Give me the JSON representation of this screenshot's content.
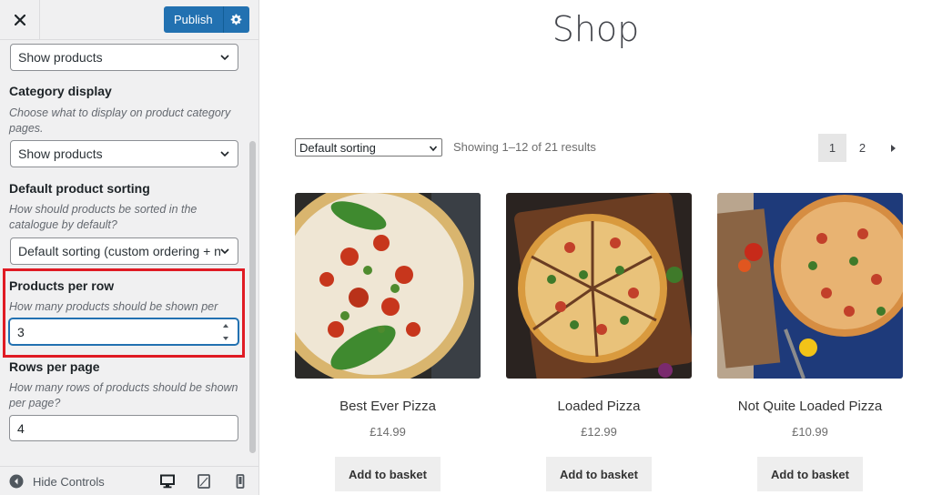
{
  "sidebar": {
    "close_label": "×",
    "publish_label": "Publish",
    "shop_page_display_value": "Show products",
    "category_display": {
      "label": "Category display",
      "description": "Choose what to display on product category pages.",
      "value": "Show products"
    },
    "default_sorting": {
      "label": "Default product sorting",
      "description": "How should products be sorted in the catalogue by default?",
      "value": "Default sorting (custom ordering + na"
    },
    "products_per_row": {
      "label": "Products per row",
      "description": "How many products should be shown per row?",
      "value": "3"
    },
    "rows_per_page": {
      "label": "Rows per page",
      "description": "How many rows of products should be shown per page?",
      "value": "4"
    },
    "footer": {
      "hide_controls_label": "Hide Controls"
    }
  },
  "preview": {
    "page_title": "Shop",
    "sorting_value": "Default sorting",
    "result_count": "Showing 1–12 of 21 results",
    "pagination": [
      "1",
      "2"
    ],
    "products": [
      {
        "name": "Best Ever Pizza",
        "price": "£14.99",
        "button": "Add to basket"
      },
      {
        "name": "Loaded Pizza",
        "price": "£12.99",
        "button": "Add to basket"
      },
      {
        "name": "Not Quite Loaded Pizza",
        "price": "£10.99",
        "button": "Add to basket"
      }
    ]
  },
  "colors": {
    "accent": "#2271b1",
    "highlight": "#e01b24",
    "sidebar_bg": "#f0f0f1"
  },
  "icons": [
    "close-icon",
    "gear-icon",
    "chevron-down-icon",
    "spinner-arrows-icon",
    "collapse-arrow-icon",
    "desktop-icon",
    "tablet-icon",
    "mobile-icon",
    "next-page-icon"
  ]
}
